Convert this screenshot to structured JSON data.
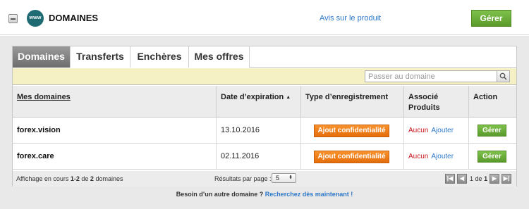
{
  "header": {
    "icon_label": "www",
    "title": "DOMAINES",
    "review_link": "Avis sur le produit",
    "manage_label": "Gérer"
  },
  "tabs": [
    {
      "label": "Domaines",
      "active": true
    },
    {
      "label": "Transferts",
      "active": false
    },
    {
      "label": "Enchères",
      "active": false
    },
    {
      "label": "Mes offres",
      "active": false
    }
  ],
  "search": {
    "placeholder": "Passer au domaine",
    "icon": "search-icon"
  },
  "table": {
    "columns": [
      "Mes domaines",
      "Date d’expiration",
      "Type d’enregistrement",
      "Associé Produits",
      "Action"
    ],
    "sort_indicator": "▲",
    "rows": [
      {
        "domain": "forex.vision",
        "expiration": "13.10.2016",
        "registration_button": "Ajout confidentialité",
        "assoc_none": "Aucun",
        "assoc_add": "Ajouter",
        "action": "Gérer"
      },
      {
        "domain": "forex.care",
        "expiration": "02.11.2016",
        "registration_button": "Ajout confidentialité",
        "assoc_none": "Aucun",
        "assoc_add": "Ajouter",
        "action": "Gérer"
      }
    ]
  },
  "footer": {
    "paging_prefix": "Affichage en cours ",
    "paging_range": "1-2",
    "paging_of": " de ",
    "paging_total": "2",
    "paging_suffix": " domaines",
    "per_page_label": "Résultats par page :",
    "per_page_value": "5",
    "page_current": "1",
    "page_of": "de",
    "page_total": "1"
  },
  "bottom_note": {
    "text": "Besoin d’un autre domaine ? ",
    "link": "Recherchez dès maintenant !"
  },
  "colors": {
    "accent_green": "#6aab37",
    "privacy_orange": "#f08321",
    "link_blue": "#2d78c8",
    "none_red": "#c8151b",
    "search_bar_bg": "#f6f1c4"
  }
}
